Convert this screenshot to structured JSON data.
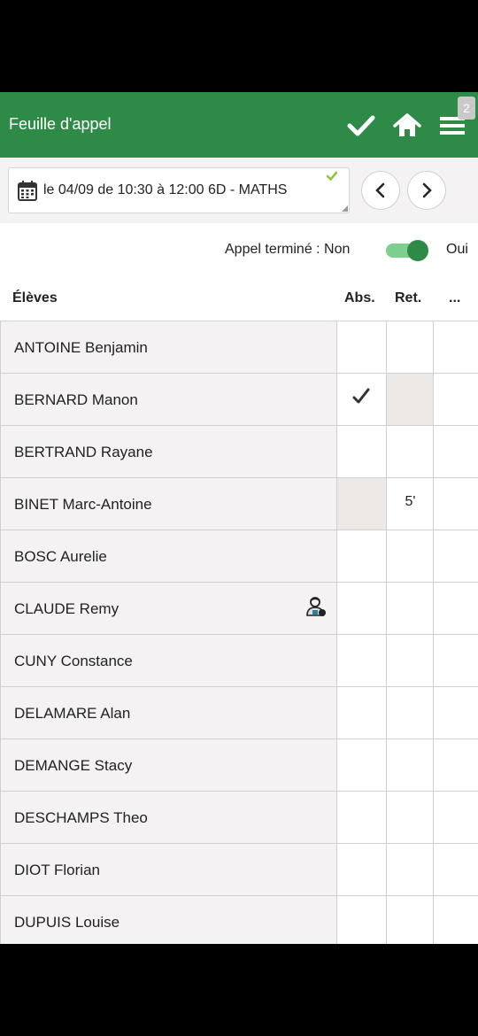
{
  "header": {
    "title": "Feuille d'appel",
    "badge": "2",
    "brand_color": "#2e8b47"
  },
  "session": {
    "text": "le 04/09 de 10:30 à 12:00 6D - MATHS"
  },
  "appel": {
    "label": "Appel terminé : Non",
    "on_label": "Oui",
    "toggle_on": true
  },
  "columns": {
    "students": "Élèves",
    "abs": "Abs.",
    "ret": "Ret.",
    "more": "..."
  },
  "students": [
    {
      "name": "ANTOINE Benjamin",
      "abs": false,
      "ret": "",
      "icon": ""
    },
    {
      "name": "BERNARD Manon",
      "abs": true,
      "ret": "",
      "icon": ""
    },
    {
      "name": "BERTRAND Rayane",
      "abs": false,
      "ret": "",
      "icon": ""
    },
    {
      "name": "BINET Marc-Antoine",
      "abs": false,
      "ret": "5'",
      "icon": ""
    },
    {
      "name": "BOSC Aurelie",
      "abs": false,
      "ret": "",
      "icon": ""
    },
    {
      "name": "CLAUDE Remy",
      "abs": false,
      "ret": "",
      "icon": "person-badge-icon"
    },
    {
      "name": "CUNY Constance",
      "abs": false,
      "ret": "",
      "icon": ""
    },
    {
      "name": "DELAMARE Alan",
      "abs": false,
      "ret": "",
      "icon": ""
    },
    {
      "name": "DEMANGE Stacy",
      "abs": false,
      "ret": "",
      "icon": ""
    },
    {
      "name": "DESCHAMPS Theo",
      "abs": false,
      "ret": "",
      "icon": ""
    },
    {
      "name": "DIOT Florian",
      "abs": false,
      "ret": "",
      "icon": ""
    },
    {
      "name": "DUPUIS Louise",
      "abs": false,
      "ret": "",
      "icon": ""
    }
  ]
}
